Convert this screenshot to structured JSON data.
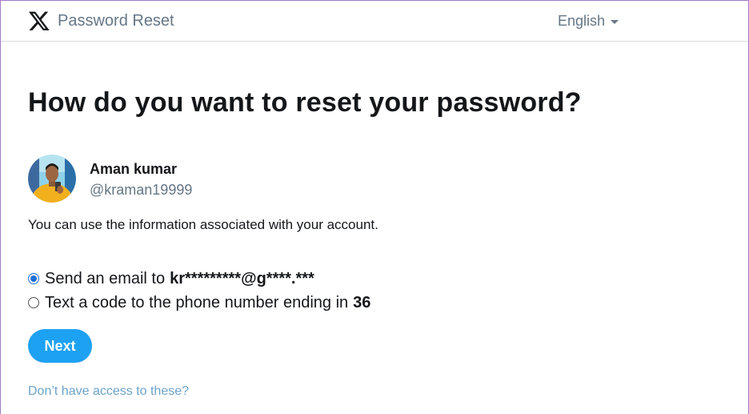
{
  "header": {
    "title": "Password Reset",
    "language": "English"
  },
  "main": {
    "headline": "How do you want to reset your password?",
    "account": {
      "name": "Aman kumar",
      "handle": "@kraman19999"
    },
    "info_text": "You can use the information associated with your account.",
    "options": [
      {
        "label": "Send an email to",
        "value": "kr*********@g****.***",
        "checked": true
      },
      {
        "label": "Text a code to the phone number ending in",
        "value": "36",
        "checked": false
      }
    ],
    "next_label": "Next",
    "no_access_link": "Don’t have access to these?"
  },
  "colors": {
    "accent": "#1da1f2",
    "muted": "#657786",
    "link": "#6ba3c9"
  }
}
